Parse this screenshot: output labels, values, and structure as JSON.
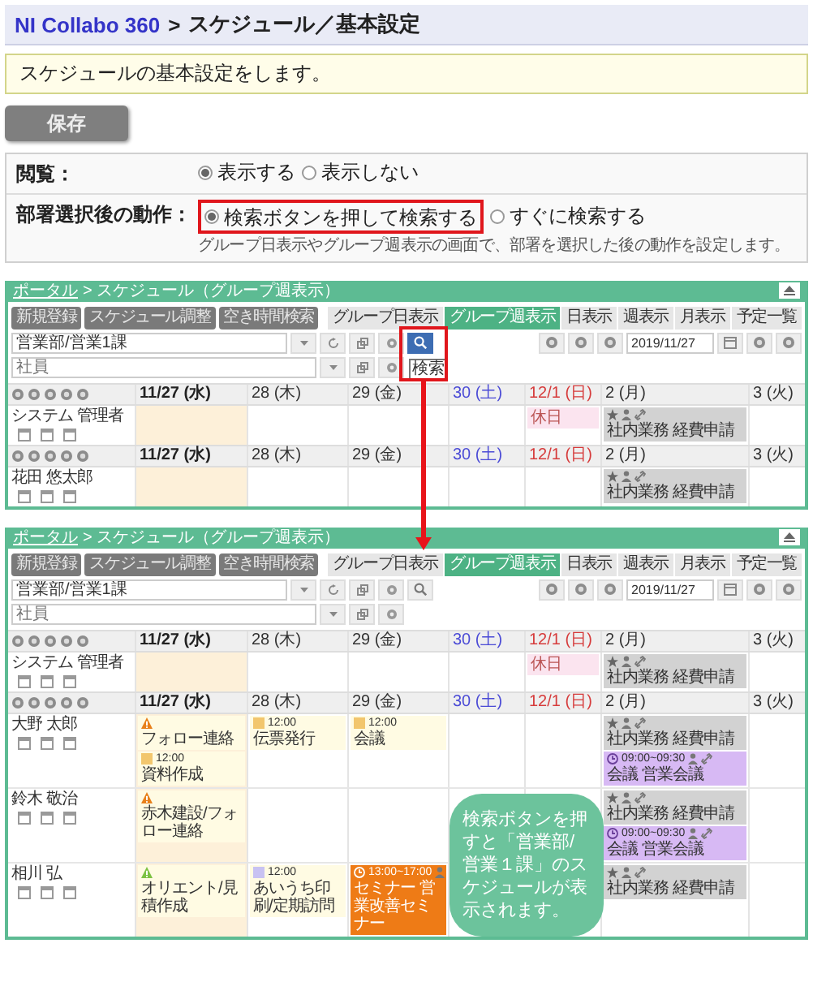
{
  "settings": {
    "breadcrumb": {
      "link": "NI Collabo 360",
      "separator": ">",
      "current": "スケジュール／基本設定"
    },
    "notice": "スケジュールの基本設定をします。",
    "save_button": "保存",
    "rows": [
      {
        "label": "閲覧：",
        "options": [
          {
            "label": "表示する",
            "selected": true,
            "highlighted": false
          },
          {
            "label": "表示しない",
            "selected": false,
            "highlighted": false
          }
        ]
      },
      {
        "label": "部署選択後の動作：",
        "options": [
          {
            "label": "検索ボタンを押して検索する",
            "selected": true,
            "highlighted": true
          },
          {
            "label": "すぐに検索する",
            "selected": false,
            "highlighted": false
          }
        ],
        "help": "グループ日表示やグループ週表示の画面で、部署を選択した後の動作を設定します。"
      }
    ]
  },
  "screens": [
    {
      "breadcrumb": {
        "link": "ポータル",
        "current": "> スケジュール（グループ週表示）"
      },
      "buttons": [
        "新規登録",
        "スケジュール調整",
        "空き時間検索"
      ],
      "tabs": [
        {
          "label": "グループ日表示",
          "selected": false
        },
        {
          "label": "グループ週表示",
          "selected": true
        },
        {
          "label": "日表示",
          "selected": false
        },
        {
          "label": "週表示",
          "selected": false
        },
        {
          "label": "月表示",
          "selected": false
        },
        {
          "label": "予定一覧",
          "selected": false
        }
      ],
      "group_field": {
        "value": "営業部/営業1課"
      },
      "member_field": {
        "placeholder": "社員"
      },
      "search_button": {
        "active": true,
        "highlighted": true,
        "tooltip": "検索"
      },
      "date_field": {
        "value": "2019/11/27"
      },
      "rows": [
        {
          "kind": "days",
          "days": [
            {
              "label": "11/27 (水)",
              "kind": "today"
            },
            {
              "label": "28 (木)",
              "kind": "weekday"
            },
            {
              "label": "29 (金)",
              "kind": "weekday"
            },
            {
              "label": "30 (土)",
              "kind": "saturday"
            },
            {
              "label": "12/1 (日)",
              "kind": "sunday"
            },
            {
              "label": "2 (月)",
              "kind": "weekday"
            },
            {
              "label": "3 (火)",
              "kind": "weekday"
            }
          ]
        },
        {
          "kind": "member",
          "name": "システム 管理者",
          "cells": [
            [],
            [],
            [],
            [],
            [
              {
                "kind": "holiday",
                "text": "休日"
              }
            ],
            [
              {
                "kind": "task",
                "text": "社内業務 経費申請"
              }
            ],
            []
          ]
        },
        {
          "kind": "days",
          "days": [
            {
              "label": "11/27 (水)",
              "kind": "today"
            },
            {
              "label": "28 (木)",
              "kind": "weekday"
            },
            {
              "label": "29 (金)",
              "kind": "weekday"
            },
            {
              "label": "30 (土)",
              "kind": "saturday"
            },
            {
              "label": "12/1 (日)",
              "kind": "sunday"
            },
            {
              "label": "2 (月)",
              "kind": "weekday"
            },
            {
              "label": "3 (火)",
              "kind": "weekday"
            }
          ]
        },
        {
          "kind": "member",
          "name": "花田 悠太郎",
          "cells": [
            [],
            [],
            [],
            [],
            [],
            [
              {
                "kind": "task",
                "text": "社内業務 経費申請"
              }
            ],
            []
          ]
        }
      ]
    },
    {
      "breadcrumb": {
        "link": "ポータル",
        "current": "> スケジュール（グループ週表示）"
      },
      "buttons": [
        "新規登録",
        "スケジュール調整",
        "空き時間検索"
      ],
      "tabs": [
        {
          "label": "グループ日表示",
          "selected": false
        },
        {
          "label": "グループ週表示",
          "selected": true
        },
        {
          "label": "日表示",
          "selected": false
        },
        {
          "label": "週表示",
          "selected": false
        },
        {
          "label": "月表示",
          "selected": false
        },
        {
          "label": "予定一覧",
          "selected": false
        }
      ],
      "group_field": {
        "value": "営業部/営業1課"
      },
      "member_field": {
        "placeholder": "社員"
      },
      "search_button": {
        "active": false,
        "highlighted": false
      },
      "date_field": {
        "value": "2019/11/27"
      },
      "rows": [
        {
          "kind": "days",
          "days": [
            {
              "label": "11/27 (水)",
              "kind": "today"
            },
            {
              "label": "28 (木)",
              "kind": "weekday"
            },
            {
              "label": "29 (金)",
              "kind": "weekday"
            },
            {
              "label": "30 (土)",
              "kind": "saturday"
            },
            {
              "label": "12/1 (日)",
              "kind": "sunday"
            },
            {
              "label": "2 (月)",
              "kind": "weekday"
            },
            {
              "label": "3 (火)",
              "kind": "weekday"
            }
          ]
        },
        {
          "kind": "member",
          "name": "システム 管理者",
          "cells": [
            [],
            [],
            [],
            [],
            [
              {
                "kind": "holiday",
                "text": "休日"
              }
            ],
            [
              {
                "kind": "task",
                "text": "社内業務 経費申請"
              }
            ],
            []
          ]
        },
        {
          "kind": "days",
          "days": [
            {
              "label": "11/27 (水)",
              "kind": "today"
            },
            {
              "label": "28 (木)",
              "kind": "weekday"
            },
            {
              "label": "29 (金)",
              "kind": "weekday"
            },
            {
              "label": "30 (土)",
              "kind": "saturday"
            },
            {
              "label": "12/1 (日)",
              "kind": "sunday"
            },
            {
              "label": "2 (月)",
              "kind": "weekday"
            },
            {
              "label": "3 (火)",
              "kind": "weekday"
            }
          ]
        },
        {
          "kind": "member",
          "name": "大野 太郎",
          "cells": [
            [
              {
                "kind": "todo",
                "color": "#e8801a",
                "text": "フォロー連絡"
              },
              {
                "kind": "appointment",
                "color": "#f2c66d",
                "time": "12:00",
                "text": "資料作成"
              }
            ],
            [
              {
                "kind": "appointment",
                "color": "#f2c66d",
                "time": "12:00",
                "text": "伝票発行"
              }
            ],
            [
              {
                "kind": "appointment",
                "color": "#f2c66d",
                "time": "12:00",
                "text": "会議"
              }
            ],
            [],
            [],
            [
              {
                "kind": "task",
                "text": "社内業務 経費申請"
              },
              {
                "kind": "meeting",
                "time": "09:00~09:30",
                "text": "会議 営業会議"
              }
            ],
            []
          ]
        },
        {
          "kind": "member",
          "name": "鈴木 敬治",
          "cells": [
            [
              {
                "kind": "todo",
                "color": "#e8801a",
                "text": "赤木建設/フォロー連絡"
              }
            ],
            [],
            [],
            [],
            [],
            [
              {
                "kind": "task",
                "text": "社内業務 経費申請"
              },
              {
                "kind": "meeting",
                "time": "09:00~09:30",
                "text": "会議 営業会議"
              }
            ],
            []
          ]
        },
        {
          "kind": "member",
          "name": "相川 弘",
          "cells": [
            [
              {
                "kind": "todo",
                "color": "#7cc242",
                "text": "オリエント/見積作成"
              }
            ],
            [
              {
                "kind": "appointment",
                "color": "#c8c2f2",
                "time": "12:00",
                "text": "あいうち印刷/定期訪問"
              }
            ],
            [
              {
                "kind": "seminar",
                "time": "13:00~17:00",
                "text": "セミナー 営業改善セミナー"
              }
            ],
            [],
            [],
            [
              {
                "kind": "task",
                "text": "社内業務 経費申請"
              }
            ],
            []
          ]
        }
      ],
      "callout": "検索ボタンを押すと「営業部/営業１課」のスケジュールが表示されます。"
    }
  ]
}
